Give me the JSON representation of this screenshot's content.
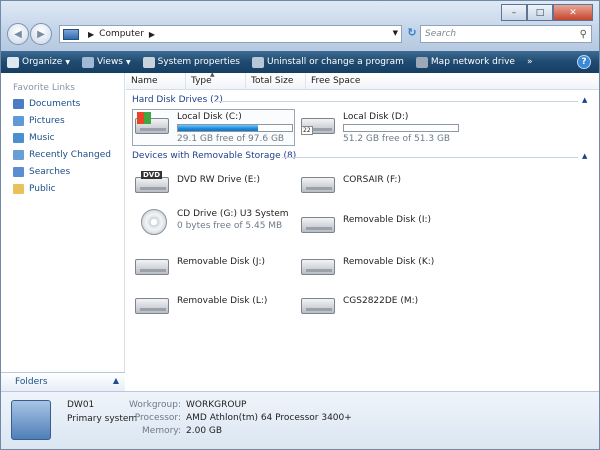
{
  "window": {
    "title": ""
  },
  "address": {
    "path_root_icon": "computer-icon",
    "path": "Computer",
    "search_placeholder": "Search"
  },
  "toolbar": {
    "organize": "Organize",
    "views": "Views",
    "system_properties": "System properties",
    "uninstall": "Uninstall or change a program",
    "map_network": "Map network drive",
    "more": "»",
    "help": "?"
  },
  "sidebar": {
    "favorites_header": "Favorite Links",
    "items": [
      {
        "label": "Documents",
        "icon": "documents-icon",
        "color": "#4c7cc4"
      },
      {
        "label": "Pictures",
        "icon": "pictures-icon",
        "color": "#5f9ad8"
      },
      {
        "label": "Music",
        "icon": "music-icon",
        "color": "#4a8fd0"
      },
      {
        "label": "Recently Changed",
        "icon": "recently-changed-icon",
        "color": "#6a9fd6"
      },
      {
        "label": "Searches",
        "icon": "searches-icon",
        "color": "#5a8ed0"
      },
      {
        "label": "Public",
        "icon": "public-icon",
        "color": "#e8c15a"
      }
    ],
    "folders_label": "Folders"
  },
  "columns": [
    "Name",
    "Type",
    "Total Size",
    "Free Space"
  ],
  "groups": {
    "hdd": "Hard Disk Drives (2)",
    "removable": "Devices with Removable Storage (8)"
  },
  "hdd": [
    {
      "name": "Local Disk (C:)",
      "free": "29.1 GB free of 97.6 GB",
      "used_fraction": 0.7
    },
    {
      "name": "Local Disk (D:)",
      "free": "51.2 GB free of 51.3 GB",
      "used_fraction": 0.002
    }
  ],
  "removable": [
    {
      "name": "DVD RW Drive (E:)",
      "sub": ""
    },
    {
      "name": "CORSAIR (F:)",
      "sub": ""
    },
    {
      "name": "CD Drive (G:) U3 System",
      "sub": "0 bytes free of 5.45 MB"
    },
    {
      "name": "Removable Disk (I:)",
      "sub": ""
    },
    {
      "name": "Removable Disk (J:)",
      "sub": ""
    },
    {
      "name": "Removable Disk (K:)",
      "sub": ""
    },
    {
      "name": "Removable Disk (L:)",
      "sub": ""
    },
    {
      "name": "CGS2822DE (M:)",
      "sub": ""
    }
  ],
  "details": {
    "computer_name": "DW01",
    "description": "Primary system",
    "workgroup_label": "Workgroup:",
    "workgroup": "WORKGROUP",
    "processor_label": "Processor:",
    "processor": "AMD Athlon(tm) 64 Processor 3400+",
    "memory_label": "Memory:",
    "memory": "2.00 GB"
  },
  "colors": {
    "accent": "#1e3f8a",
    "toolbar": "#1f4a70",
    "link": "#1c4f8a"
  }
}
